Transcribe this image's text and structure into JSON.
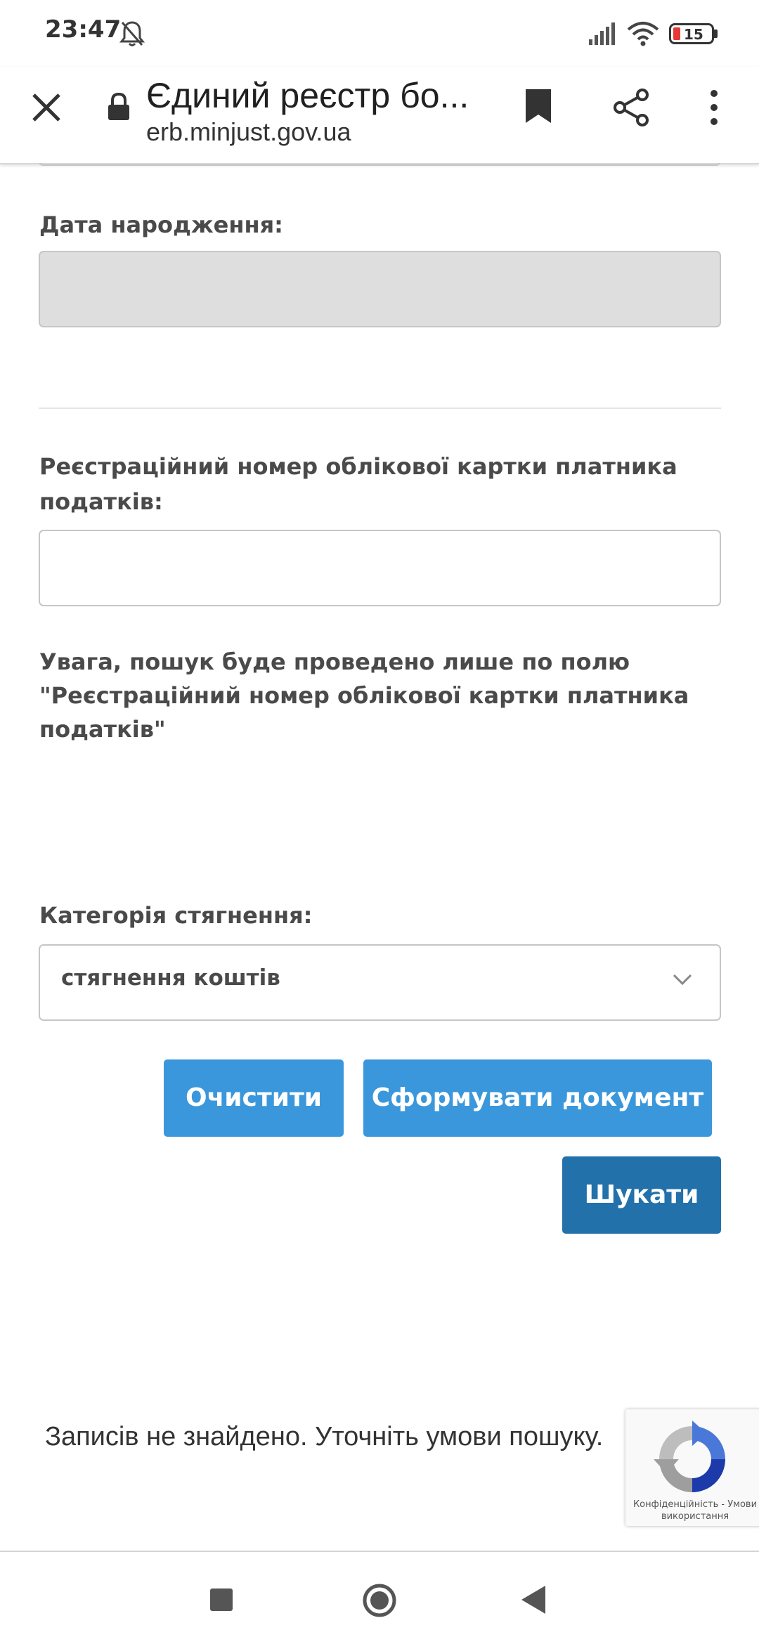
{
  "status_bar": {
    "time": "23:47",
    "battery_level": "15"
  },
  "browser": {
    "title": "Єдиний реєстр бо...",
    "url": "erb.minjust.gov.ua"
  },
  "form": {
    "birth_date_label": "Дата народження:",
    "tax_number_label": "Реєстраційний номер облікової картки платника податків:",
    "search_note": "Увага, пошук буде проведено лише по полю \"Реєстраційний номер облікової картки платника податків\"",
    "category_label": "Категорія стягнення:",
    "category_value": "стягнення коштів"
  },
  "buttons": {
    "clear": "Очистити",
    "generate": "Сформувати документ",
    "search": "Шукати"
  },
  "results": {
    "message": "Записів не знайдено. Уточніть умови пошуку."
  },
  "recaptcha": {
    "privacy": "Конфіденційність",
    "separator": "-",
    "terms": "Умови використання"
  },
  "colors": {
    "primary_button": "#3a97dc",
    "search_button": "#2271aa",
    "battery_low": "#e53935"
  }
}
